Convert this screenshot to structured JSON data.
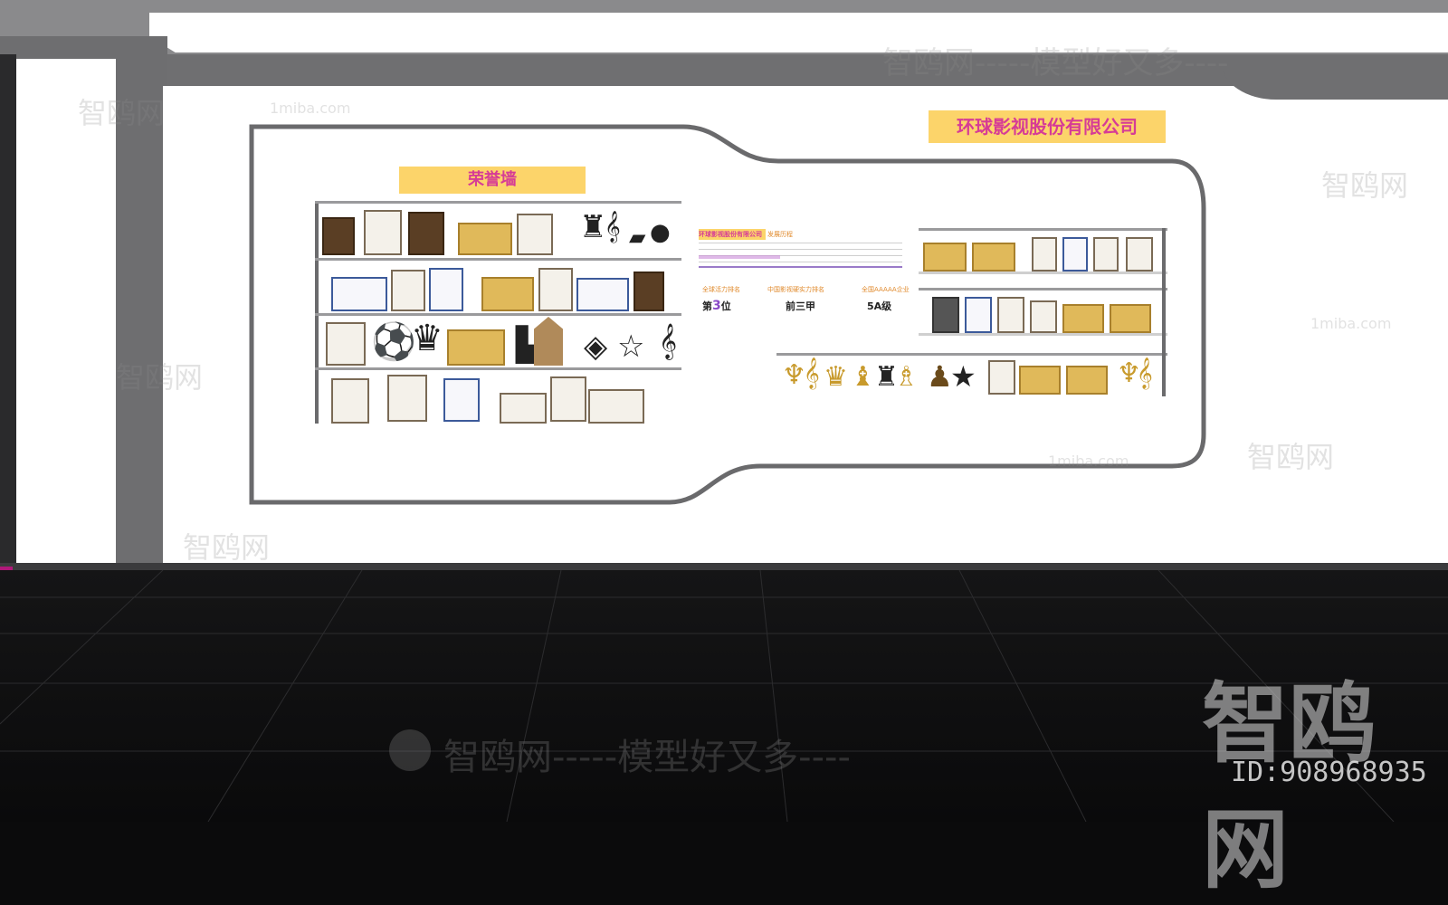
{
  "company_title": "环球影视股份有限公司",
  "honor_wall_title": "荣誉墙",
  "intro": {
    "heading_company": "环球影视股份有限公司",
    "heading_suffix": "发展历程"
  },
  "stats": [
    {
      "label": "全球活力排名",
      "prefix": "第",
      "value": "3",
      "suffix": "位"
    },
    {
      "label": "中国影视硬实力排名",
      "prefix": "",
      "value": "前三甲",
      "suffix": ""
    },
    {
      "label": "全国AAAAA企业",
      "prefix": "",
      "value": "5A级",
      "suffix": ""
    }
  ],
  "watermarks": {
    "main": "智鸥网",
    "slogan": "智鸥网-----模型好又多----",
    "site": "1miba.com",
    "id": "ID:908968935"
  },
  "colors": {
    "title_bg": "#fcd46a",
    "title_text": "#d63c96",
    "accent_purple": "#9a7ac8"
  }
}
